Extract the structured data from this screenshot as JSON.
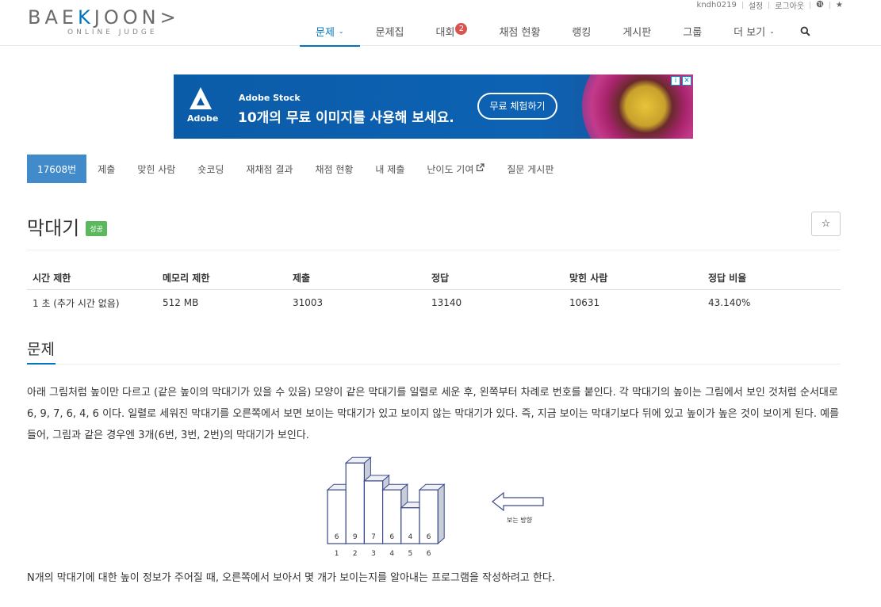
{
  "logo": {
    "main_prefix": "BAE",
    "main_k": "K",
    "main_suffix": "JOON>",
    "sub": "ONLINE JUDGE"
  },
  "topbar": {
    "username": "kndh0219",
    "settings": "설정",
    "logout": "로그아웃",
    "globe_icon": "globe-icon",
    "star_icon": "star-icon"
  },
  "nav": {
    "items": [
      {
        "label": "문제",
        "caret": "⌄"
      },
      {
        "label": "문제집"
      },
      {
        "label": "대회",
        "badge": "2"
      },
      {
        "label": "채점 현황"
      },
      {
        "label": "랭킹"
      },
      {
        "label": "게시판"
      },
      {
        "label": "그룹"
      },
      {
        "label": "더 보기",
        "caret": "⌄"
      }
    ],
    "search_icon": "search-icon",
    "active_color": "#0076C0"
  },
  "ad": {
    "logo_word": "Adobe",
    "brand": "Adobe Stock",
    "headline": "10개의 무료 이미지를 사용해 보세요.",
    "cta": "무료 체험하기",
    "info_glyph": "i",
    "close_glyph": "✕"
  },
  "problem_tabs": [
    "17608번",
    "제출",
    "맞힌 사람",
    "숏코딩",
    "재채점 결과",
    "채점 현황",
    "내 제출",
    "난이도 기여",
    "질문 게시판"
  ],
  "problem": {
    "title": "막대기",
    "status_label": "성공",
    "star_glyph": "☆"
  },
  "info_table": {
    "headers": [
      "시간 제한",
      "메모리 제한",
      "제출",
      "정답",
      "맞힌 사람",
      "정답 비율"
    ],
    "values": [
      "1 초 (추가 시간 없음)",
      "512 MB",
      "31003",
      "13140",
      "10631",
      "43.140%"
    ]
  },
  "section": {
    "heading": "문제",
    "paragraph": "아래 그림처럼 높이만 다르고 (같은 높이의 막대기가 있을 수 있음) 모양이 같은 막대기를 일렬로 세운 후, 왼쪽부터 차례로 번호를 붙인다. 각 막대기의 높이는 그림에서 보인 것처럼 순서대로 6, 9, 7, 6, 4, 6 이다. 일렬로 세워진 막대기를 오른쪽에서 보면 보이는 막대기가 있고 보이지 않는 막대기가 있다. 즉, 지금 보이는 막대기보다 뒤에 있고 높이가 높은 것이 보이게 된다. 예를 들어, 그림과 같은 경우엔 3개(6번, 3번, 2번)의 막대기가 보인다.",
    "paragraph2": "N개의 막대기에 대한 높이 정보가 주어질 때, 오른쪽에서 보아서 몇 개가 보이는지를 알아내는 프로그램을 작성하려고 한다."
  },
  "figure": {
    "heights": [
      6,
      9,
      7,
      6,
      4,
      6
    ],
    "indices": [
      "1",
      "2",
      "3",
      "4",
      "5",
      "6"
    ],
    "arrow_label": "보는 방향"
  }
}
